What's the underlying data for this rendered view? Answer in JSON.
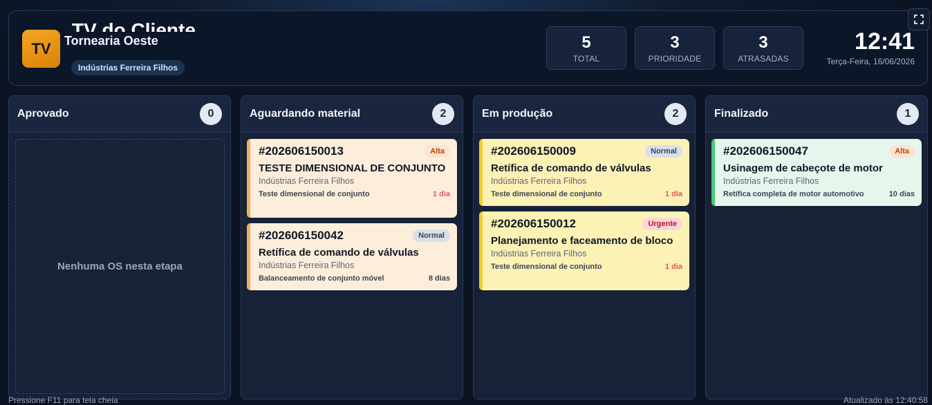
{
  "header": {
    "logo_text": "TV",
    "app_title": "TV do Cliente",
    "company": "Tornearia Oeste",
    "client": "Indústrias Ferreira Filhos"
  },
  "stats": [
    {
      "value": "5",
      "label": "TOTAL"
    },
    {
      "value": "3",
      "label": "PRIORIDADE"
    },
    {
      "value": "3",
      "label": "ATRASADAS"
    }
  ],
  "clock": {
    "time": "12:41",
    "date": "Terça-Feira, 16/06/2026"
  },
  "icons": {
    "fullscreen": "fullscreen-icon"
  },
  "columns": [
    {
      "title": "Aprovado",
      "count": "0",
      "empty_text": "Nenhuma OS nesta etapa",
      "cards": []
    },
    {
      "title": "Aguardando material",
      "count": "2",
      "cards": [
        {
          "number": "#202606150013",
          "priority": "Alta",
          "title": "TESTE DIMENSIONAL DE CONJUNTO",
          "client": "Indústrias Ferreira Filhos",
          "service": "Teste dimensional de conjunto",
          "days": "1 dia",
          "color": "#f0b257"
        },
        {
          "number": "#202606150042",
          "priority": "Normal",
          "title": "Retífica de comando de válvulas",
          "client": "Indústrias Ferreira Filhos",
          "service": "Balanceamento de conjunto móvel",
          "days": "8 dias",
          "color": "#f0b257"
        }
      ]
    },
    {
      "title": "Em produção",
      "count": "2",
      "cards": [
        {
          "number": "#202606150009",
          "priority": "Normal",
          "title": "Retífica de comando de válvulas",
          "client": "Indústrias Ferreira Filhos",
          "service": "Teste dimensional de conjunto",
          "days": "1 dia",
          "color": "#f1cd2d"
        },
        {
          "number": "#202606150012",
          "priority": "Urgente",
          "title": "Planejamento e faceamento de bloco",
          "client": "Indústrias Ferreira Filhos",
          "service": "Teste dimensional de conjunto",
          "days": "1 dia",
          "color": "#f1cd2d"
        }
      ]
    },
    {
      "title": "Finalizado",
      "count": "1",
      "cards": [
        {
          "number": "#202606150047",
          "priority": "Alta",
          "title": "Usinagem de cabeçote de motor",
          "client": "Indústrias Ferreira Filhos",
          "service": "Retífica completa de motor automotivo",
          "days": "10 dias",
          "color": "#4cc57a"
        }
      ]
    }
  ],
  "footer": {
    "hint": "Pressione F11 para tela cheia",
    "updated": "Atualizado às 12:40:58"
  }
}
